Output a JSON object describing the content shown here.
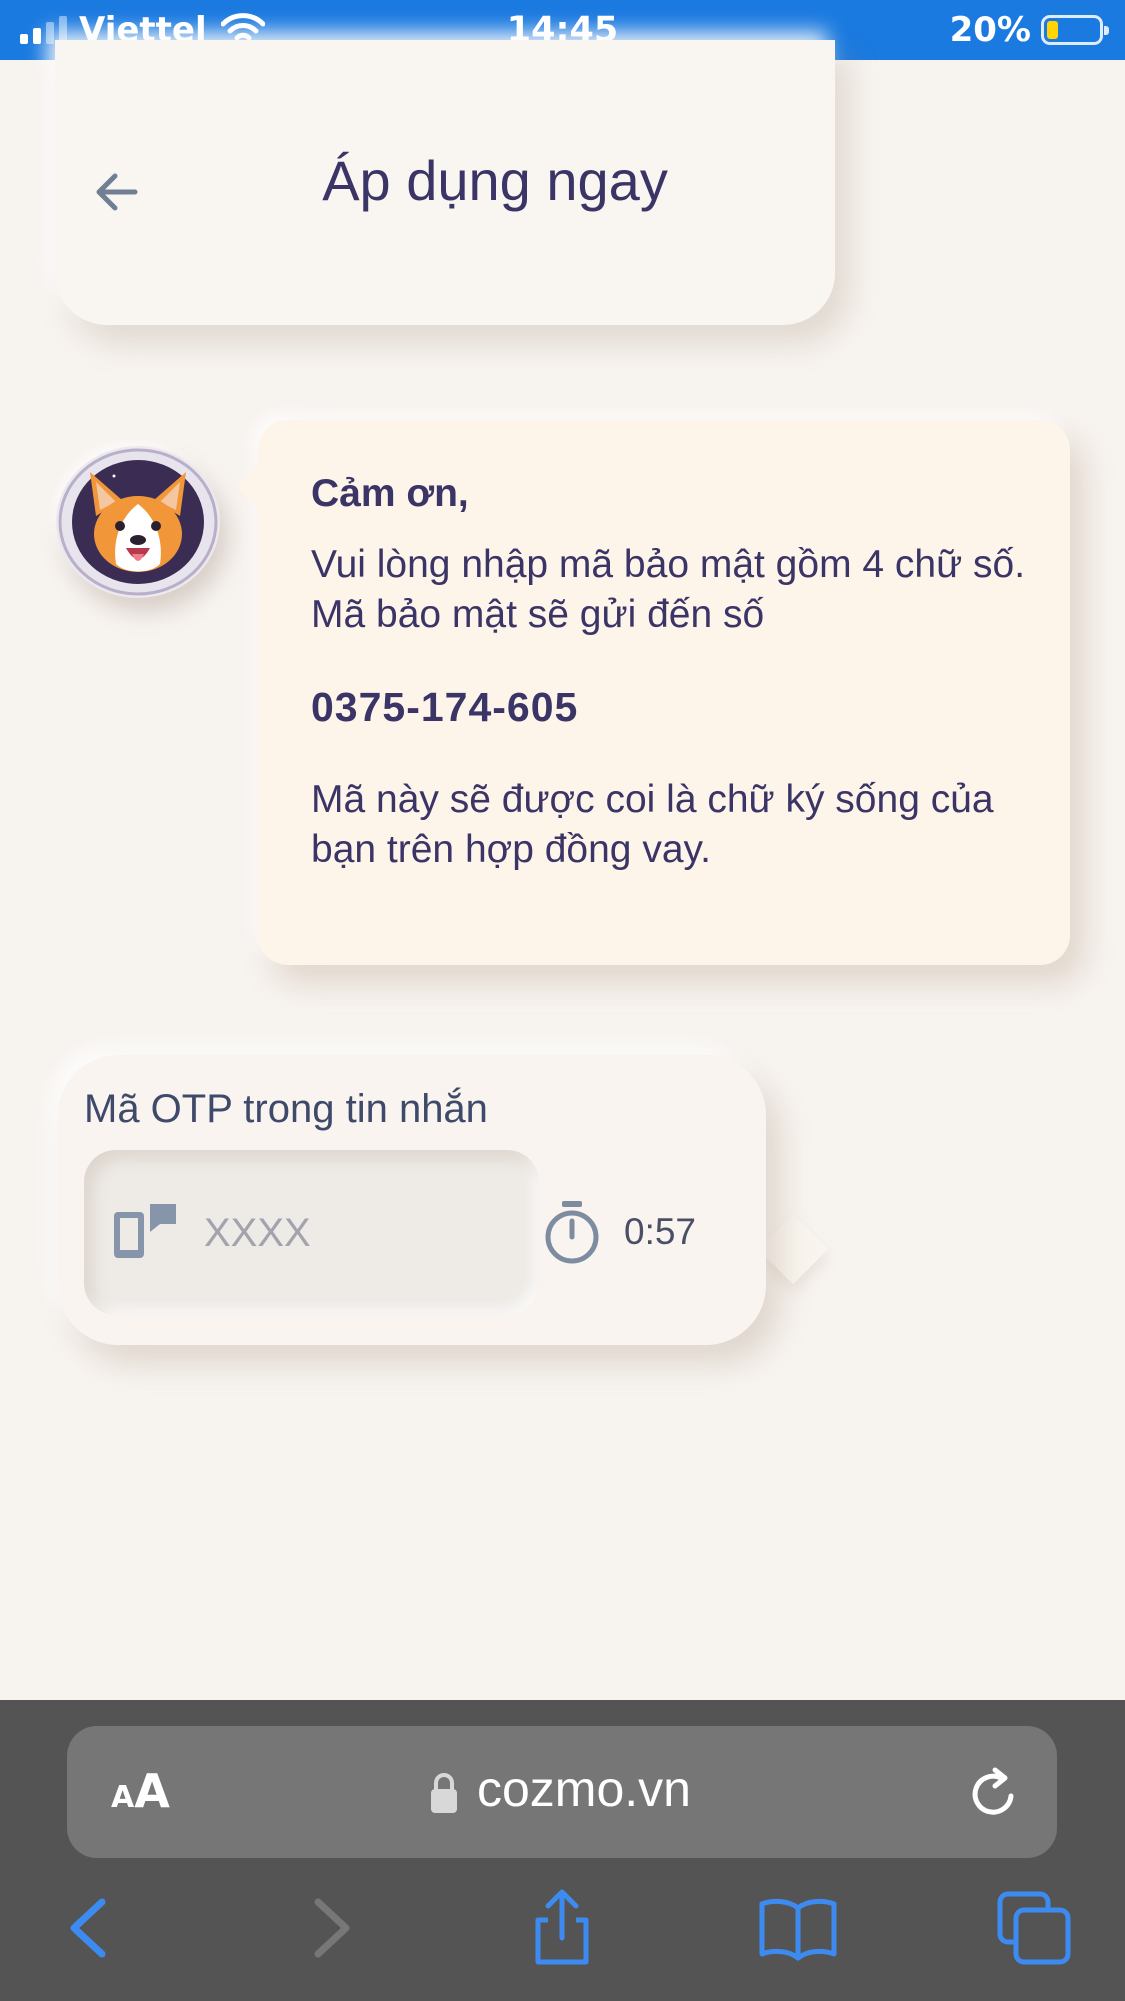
{
  "status_bar": {
    "carrier": "Viettel",
    "time": "14:45",
    "battery_percent": "20%"
  },
  "header": {
    "title": "Áp dụng ngay"
  },
  "message": {
    "greeting": "Cảm ơn,",
    "line1": "Vui lòng nhập mã bảo mật gồm 4 chữ số. Mã bảo mật sẽ gửi đến số",
    "phone": "0375-174-605",
    "line2": "Mã này sẽ được coi là chữ ký sống của bạn trên hợp đồng vay."
  },
  "otp": {
    "label": "Mã OTP trong tin nhắn",
    "placeholder": "XXXX",
    "timer": "0:57"
  },
  "browser": {
    "text_size_small": "A",
    "text_size_big": "A",
    "url": "cozmo.vn"
  },
  "colors": {
    "status_bar": "#1b7ae0",
    "text_primary": "#3b3466",
    "bubble_bg": "#fdf5ea",
    "page_bg": "#f7f3ef",
    "toolbar_bg": "#545454",
    "safari_blue": "#3d8bf0"
  }
}
